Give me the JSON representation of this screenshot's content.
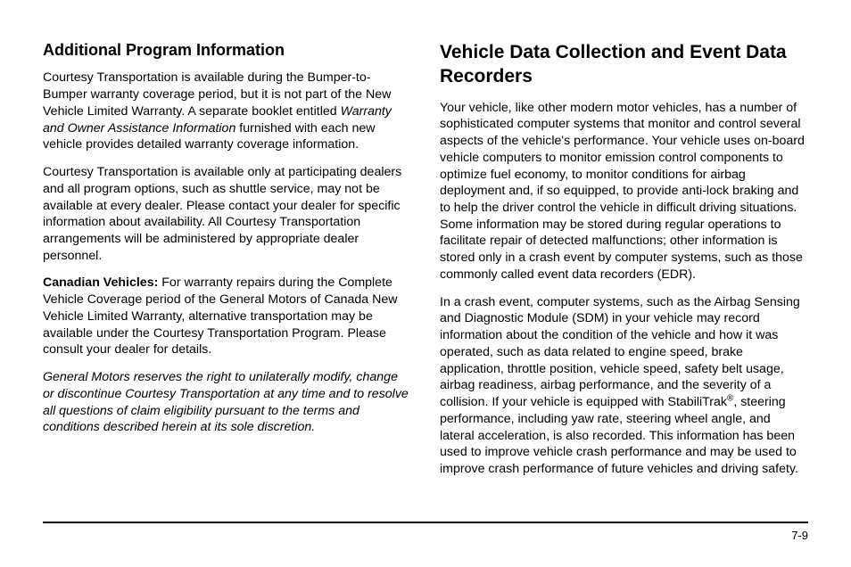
{
  "left": {
    "heading": "Additional Program Information",
    "p1_a": "Courtesy Transportation is available during the Bumper-to-Bumper warranty coverage period, but it is not part of the New Vehicle Limited Warranty. A separate booklet entitled ",
    "p1_i": "Warranty and Owner Assistance Information",
    "p1_b": " furnished with each new vehicle provides detailed warranty coverage information.",
    "p2": "Courtesy Transportation is available only at participating dealers and all program options, such as shuttle service, may not be available at every dealer. Please contact your dealer for specific information about availability. All Courtesy Transportation arrangements will be administered by appropriate dealer personnel.",
    "p3_lead": "Canadian Vehicles:",
    "p3_rest": " For warranty repairs during the Complete Vehicle Coverage period of the General Motors of Canada New Vehicle Limited Warranty, alternative transportation may be available under the Courtesy Transportation Program. Please consult your dealer for details.",
    "p4": "General Motors reserves the right to unilaterally modify, change or discontinue Courtesy Transportation at any time and to resolve all questions of claim eligibility pursuant to the terms and conditions described herein at its sole discretion."
  },
  "right": {
    "heading": "Vehicle Data Collection and Event Data Recorders",
    "p1": "Your vehicle, like other modern motor vehicles, has a number of sophisticated computer systems that monitor and control several aspects of the vehicle's performance. Your vehicle uses on-board vehicle computers to monitor emission control components to optimize fuel economy, to monitor conditions for airbag deployment and, if so equipped, to provide anti-lock braking and to help the driver control the vehicle in difficult driving situations. Some information may be stored during regular operations to facilitate repair of detected malfunctions; other information is stored only in a crash event by computer systems, such as those commonly called event data recorders (EDR).",
    "p2_a": "In a crash event, computer systems, such as the Airbag Sensing and Diagnostic Module (SDM) in your vehicle may record information about the condition of the vehicle and how it was operated, such as data related to engine speed, brake application, throttle position, vehicle speed, safety belt usage, airbag readiness, airbag performance, and the severity of a collision. If your vehicle is equipped with StabiliTrak",
    "p2_sup": "®",
    "p2_b": ", steering performance, including yaw rate, steering wheel angle, and lateral acceleration, is also recorded. This information has been used to improve vehicle crash performance and may be used to improve crash performance of future vehicles and driving safety."
  },
  "page_number": "7-9"
}
